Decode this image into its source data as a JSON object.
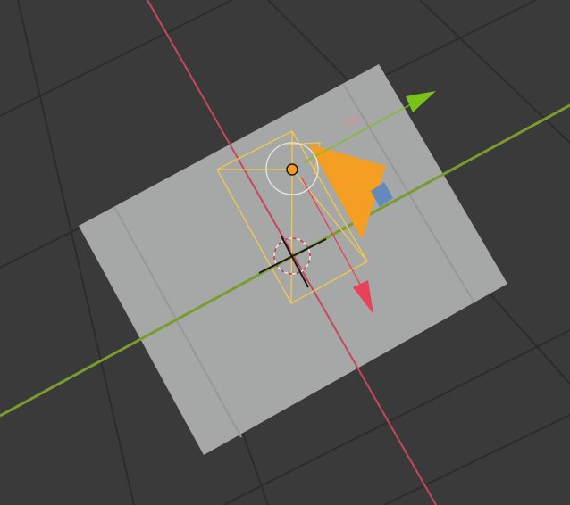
{
  "viewport": {
    "name": "3d-viewport",
    "background_color": "#3a3a3a",
    "grid_color": "#2b2b2b"
  },
  "scene": {
    "plane": {
      "color": "#a6a7a7"
    },
    "axes": {
      "x_axis_color": "#c4485a",
      "y_axis_color": "#7a9c2e"
    },
    "selected_object": {
      "type": "camera",
      "outline_color": "#f3c84b",
      "origin_color": "#f39c1f"
    },
    "gizmo": {
      "x_arrow_color": "#e8425a",
      "y_arrow_color": "#79c21a",
      "z_handle_color": "#5b87c0",
      "up_triangle_color": "#f49e23",
      "rotate_ring_color": "#e6e6e6",
      "cursor_ring_color": "#e6e6e6",
      "cursor_ring_accent": "#d04040"
    }
  }
}
